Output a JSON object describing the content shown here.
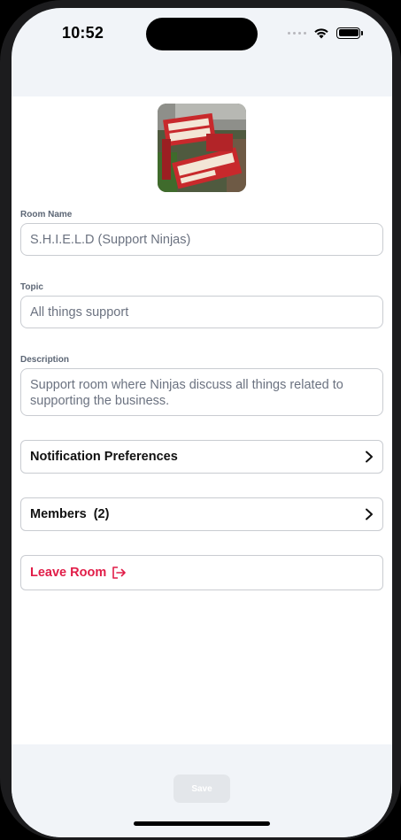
{
  "status_bar": {
    "time": "10:52",
    "icons": [
      "signal-dots-icon",
      "wifi-icon",
      "battery-icon"
    ]
  },
  "room": {
    "image": "room-avatar-image",
    "name_label": "Room Name",
    "name_value": "S.H.I.E.L.D (Support Ninjas)",
    "topic_label": "Topic",
    "topic_value": "All things support",
    "description_label": "Description",
    "description_value": "Support room where Ninjas discuss all things related to supporting the business."
  },
  "actions": {
    "notification_preferences": "Notification Preferences",
    "members": "Members",
    "members_count": "(2)",
    "leave_room": "Leave Room"
  },
  "footer": {
    "save_label": "Save"
  },
  "colors": {
    "danger": "#e11d48",
    "background": "#f1f4f8",
    "border": "#c9ccd1"
  }
}
